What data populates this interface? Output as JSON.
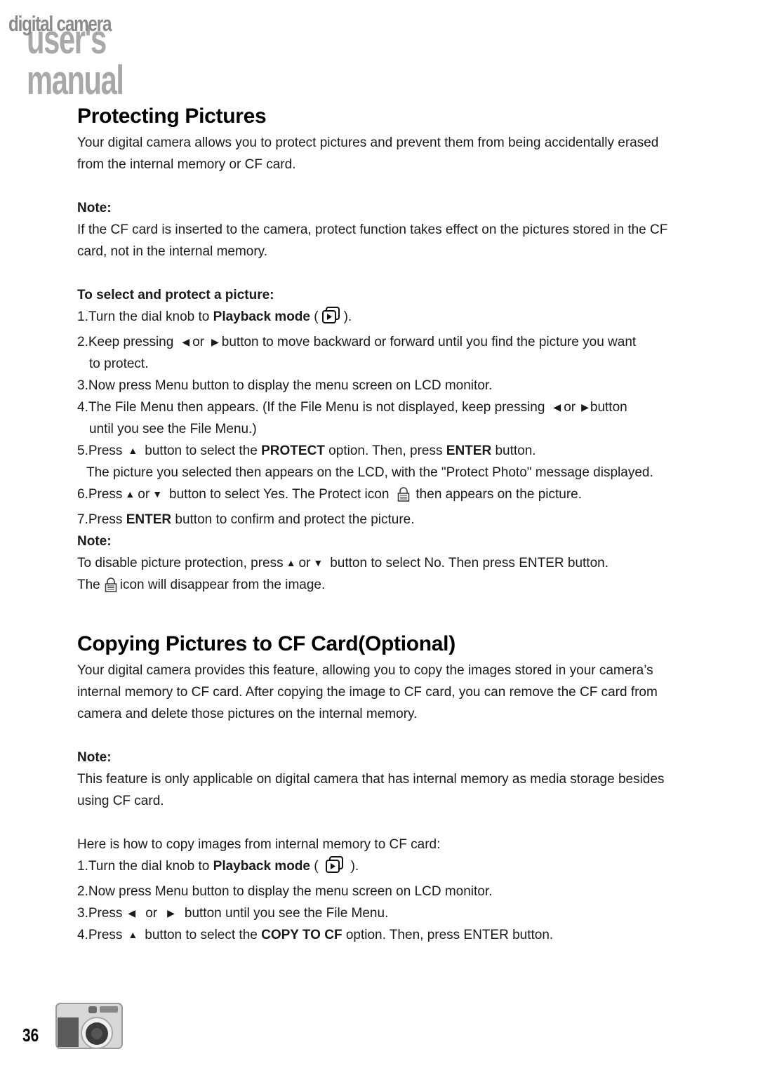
{
  "header": {
    "logo_line1": "digital camera",
    "logo_line2": "user's manual"
  },
  "section1": {
    "title": "Protecting Pictures",
    "intro": "Your digital camera allows you to protect pictures and prevent them from being accidentally erased from the internal memory or CF card.",
    "note_label": "Note:",
    "note_text": "If the CF card is inserted to the camera, protect function takes effect on the pictures stored in the CF card, not in the internal memory.",
    "steps_heading": "To select and protect a picture:",
    "step1_a": "1.Turn the dial knob to ",
    "step1_b": "Playback mode",
    "step1_c": " (",
    "step1_d": ").",
    "step2_a": "2.Keep pressing",
    "step2_or": "or",
    "step2_b": "button to move backward or forward until you find the picture you want",
    "step2_c": "to protect.",
    "step3": "3.Now press Menu button to display the menu screen on LCD monitor.",
    "step4_a": "4.The File Menu then appears. (If the File Menu is not displayed, keep pressing",
    "step4_or": "or",
    "step4_b": "button",
    "step4_c": "until you see the File Menu.)",
    "step5_a": "5.Press",
    "step5_b": "button to select the ",
    "step5_c": "PROTECT",
    "step5_d": " option. Then, press ",
    "step5_e": "ENTER",
    "step5_f": " button.",
    "step5_g": "The picture you selected then appears on the LCD, with the \"Protect Photo\" message displayed.",
    "step6_a": "6.Press",
    "step6_or": "or",
    "step6_b": "button to select Yes. The Protect icon",
    "step6_c": "then appears on the picture.",
    "step7_a": "7.Press ",
    "step7_b": "ENTER",
    "step7_c": " button to confirm and protect the picture.",
    "note2_label": "Note:",
    "note2_a": "To disable picture protection, press",
    "note2_or": "or",
    "note2_b": "button to select No. Then press ENTER button.",
    "note2_c": "The",
    "note2_d": "icon will disappear from the image."
  },
  "section2": {
    "title": "Copying Pictures to CF Card(Optional)",
    "intro": "Your digital camera provides this feature, allowing you to copy the images stored in your camera’s internal memory to CF card. After copying the image to CF card, you can remove the CF card from camera and delete those pictures on the internal memory.",
    "note_label": "Note:",
    "note_text": "This feature is only applicable on digital camera that has internal memory as media storage besides using CF card.",
    "howto": "Here is how to copy images from internal memory to CF card:",
    "step1_a": "1.Turn the dial knob to ",
    "step1_b": "Playback mode",
    "step1_c": " (",
    "step1_d": ").",
    "step2": "2.Now press Menu button to display the menu screen on LCD monitor.",
    "step3_a": "3.Press",
    "step3_or": "or",
    "step3_b": "button until you see the File Menu.",
    "step4_a": "4.Press",
    "step4_b": "button to select the ",
    "step4_c": "COPY TO CF",
    "step4_d": " option. Then, press ENTER button."
  },
  "footer": {
    "page_number": "36"
  },
  "icons": {
    "left": "◀",
    "right": "▶",
    "up": "▲",
    "down": "▼"
  }
}
